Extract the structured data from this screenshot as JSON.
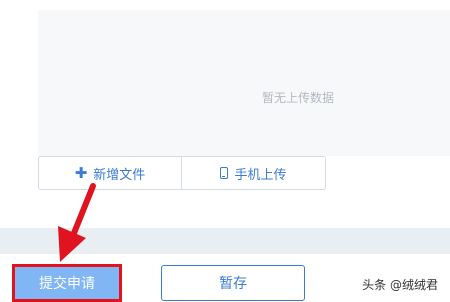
{
  "upload": {
    "empty_text": "暂无上传数据",
    "new_file_label": "新增文件",
    "phone_upload_label": "手机上传"
  },
  "actions": {
    "submit_label": "提交申请",
    "draft_label": "暂存"
  },
  "watermark": "头条 @绒绒君",
  "colors": {
    "accent": "#3a7bd5",
    "submit_bg": "#7fb6f3",
    "highlight": "#e0141f",
    "drop_area_bg": "#f6f8fa"
  }
}
